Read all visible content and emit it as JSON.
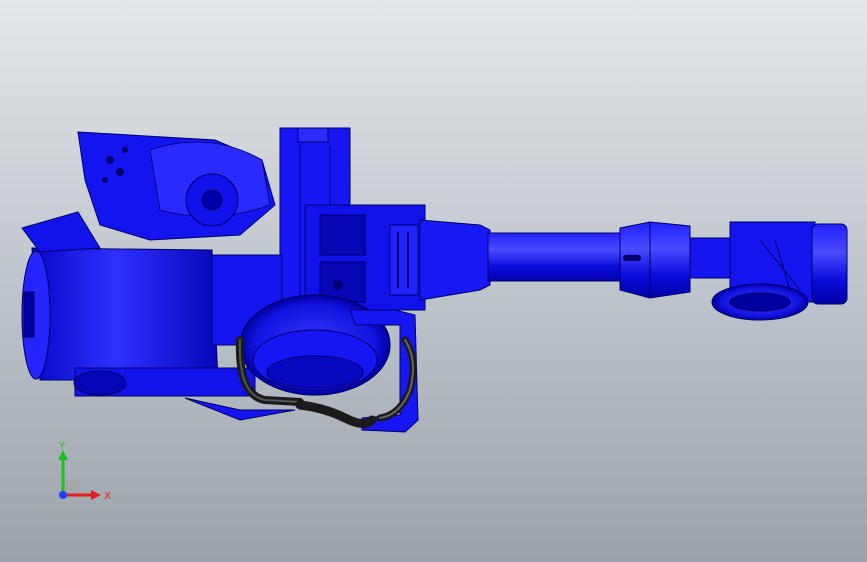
{
  "viewport": {
    "background_top": "#e4e7eb",
    "background_bottom": "#9ba2aa",
    "model_color": "#1010ee",
    "model_dark": "#0000a0",
    "model_light": "#3a3aff",
    "hose_color": "#1a1a1a"
  },
  "model": {
    "name": "robot-arm-assembly",
    "icon": "robot-arm-icon"
  },
  "triad": {
    "x_label": "X",
    "y_label": "Y",
    "x_color": "#e02020",
    "y_color": "#20c020",
    "z_color": "#2040ff"
  }
}
